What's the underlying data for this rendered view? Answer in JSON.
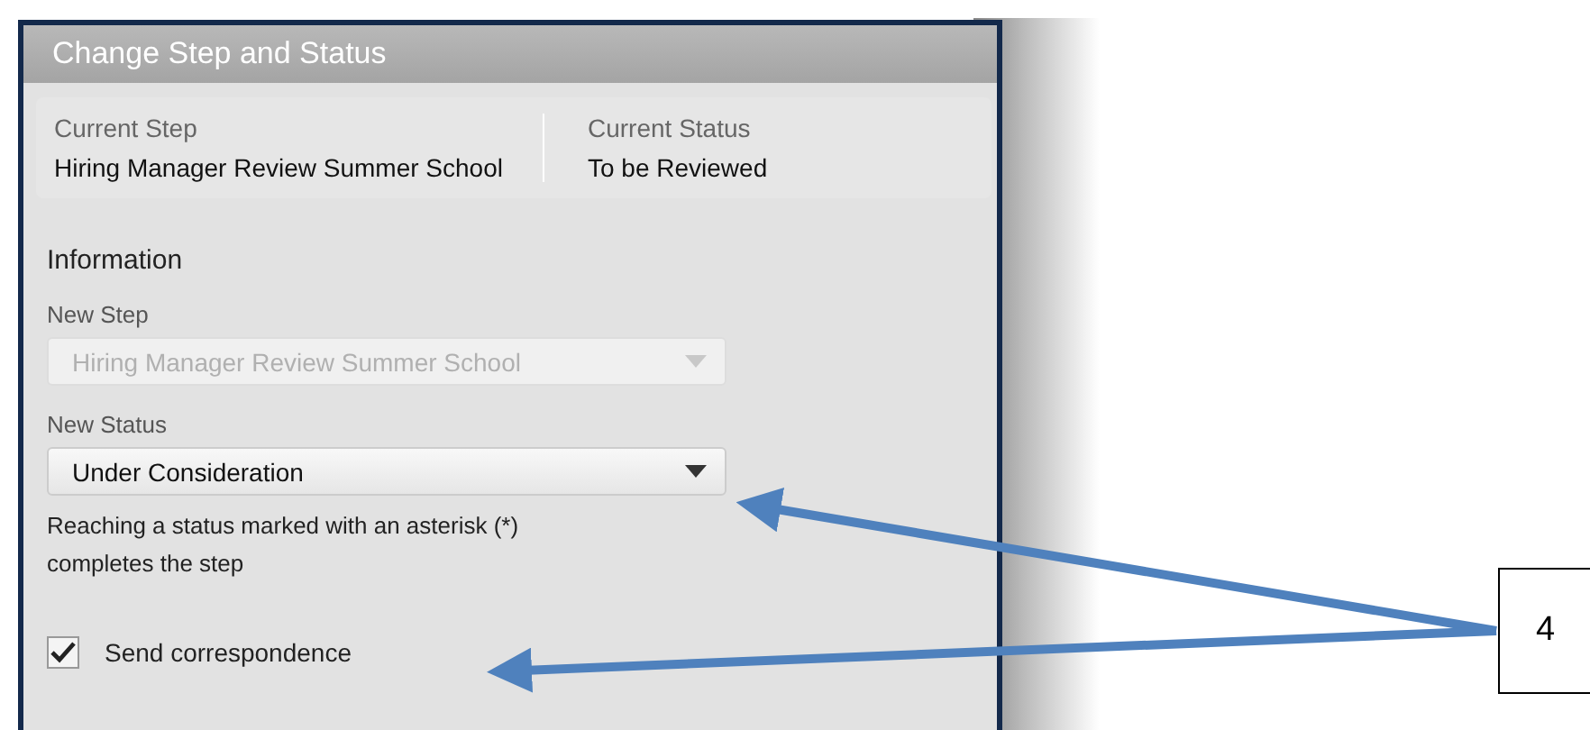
{
  "dialog": {
    "title": "Change Step and Status"
  },
  "current": [
    {
      "label": "Current Step",
      "value": "Hiring Manager Review Summer School"
    },
    {
      "label": "Current Status",
      "value": "To be Reviewed"
    }
  ],
  "section": "Information",
  "fields": [
    {
      "label": "New Step",
      "value": "Hiring Manager Review Summer School",
      "disabled": true
    },
    {
      "label": "New Status",
      "value": "Under Consideration",
      "disabled": false
    }
  ],
  "hint": "Reaching a status marked with an asterisk (*) completes the step",
  "correspondence": {
    "label": "Send correspondence",
    "checked": true
  },
  "callout": {
    "label": "4"
  }
}
